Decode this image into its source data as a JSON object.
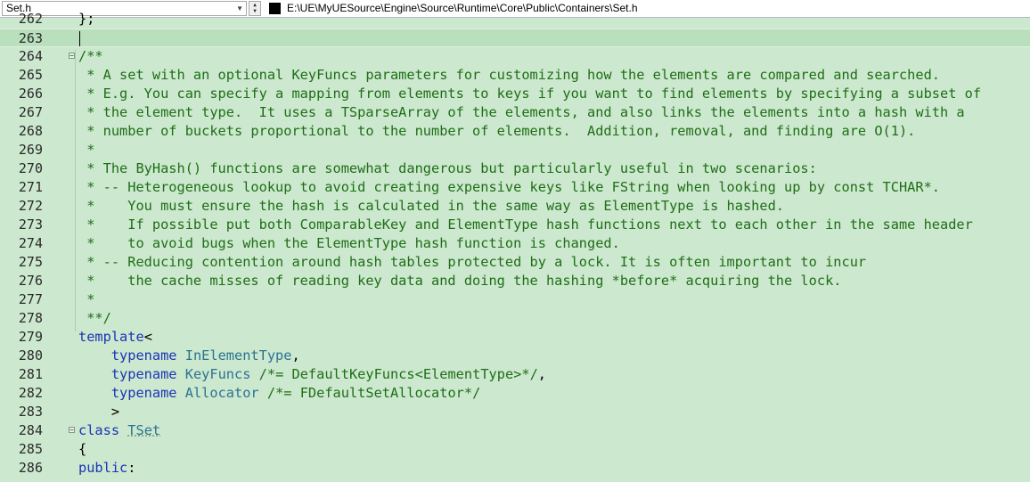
{
  "toolbar": {
    "file_selector": "Set.h",
    "file_path": "E:\\UE\\MyUESource\\Engine\\Source\\Runtime\\Core\\Public\\Containers\\Set.h"
  },
  "editor": {
    "partial_top": {
      "number": "262",
      "text": "};"
    },
    "lines": [
      {
        "number": "263",
        "text": ""
      },
      {
        "number": "264",
        "text": "/**"
      },
      {
        "number": "265",
        "text": " * A set with an optional KeyFuncs parameters for customizing how the elements are compared and searched."
      },
      {
        "number": "266",
        "text": " * E.g. You can specify a mapping from elements to keys if you want to find elements by specifying a subset of"
      },
      {
        "number": "267",
        "text": " * the element type.  It uses a TSparseArray of the elements, and also links the elements into a hash with a"
      },
      {
        "number": "268",
        "text": " * number of buckets proportional to the number of elements.  Addition, removal, and finding are O(1)."
      },
      {
        "number": "269",
        "text": " *"
      },
      {
        "number": "270",
        "text": " * The ByHash() functions are somewhat dangerous but particularly useful in two scenarios:"
      },
      {
        "number": "271",
        "text": " * -- Heterogeneous lookup to avoid creating expensive keys like FString when looking up by const TCHAR*."
      },
      {
        "number": "272",
        "text": " *    You must ensure the hash is calculated in the same way as ElementType is hashed."
      },
      {
        "number": "273",
        "text": " *    If possible put both ComparableKey and ElementType hash functions next to each other in the same header"
      },
      {
        "number": "274",
        "text": " *    to avoid bugs when the ElementType hash function is changed."
      },
      {
        "number": "275",
        "text": " * -- Reducing contention around hash tables protected by a lock. It is often important to incur"
      },
      {
        "number": "276",
        "text": " *    the cache misses of reading key data and doing the hashing *before* acquiring the lock."
      },
      {
        "number": "277",
        "text": " *"
      },
      {
        "number": "278",
        "text": " **/"
      },
      {
        "number": "279",
        "kw": "template",
        "rest": "<"
      },
      {
        "number": "280",
        "kw": "typename",
        "ty": "InElementType",
        "rest": ","
      },
      {
        "number": "281",
        "kw": "typename",
        "ty": "KeyFuncs",
        "comment": "/*= DefaultKeyFuncs<ElementType>*/",
        "rest": ","
      },
      {
        "number": "282",
        "kw": "typename",
        "ty": "Allocator",
        "comment": "/*= FDefaultSetAllocator*/"
      },
      {
        "number": "283",
        "rest": ">"
      },
      {
        "number": "284",
        "kw": "class",
        "ty": "TSet"
      },
      {
        "number": "285",
        "rest": "{"
      },
      {
        "number": "286",
        "kw": "public",
        "rest": ":"
      }
    ]
  },
  "colors": {
    "background": "#cce8cf",
    "comment": "#1f6e16",
    "keyword": "#1b35b5",
    "type": "#2b7391"
  },
  "icons": {
    "dropdown": "chevron-down-icon",
    "spinner": "spinner-icon",
    "file": "file-icon",
    "fold": "fold-toggle-icon"
  }
}
